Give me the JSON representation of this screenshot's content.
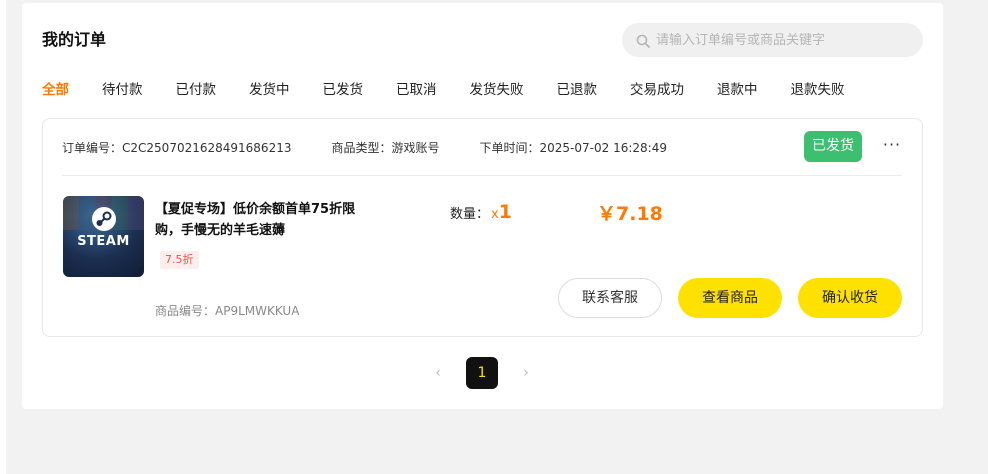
{
  "page": {
    "title": "我的订单"
  },
  "search": {
    "placeholder": "请输入订单编号或商品关键字",
    "icon": "search-icon"
  },
  "tabs": [
    {
      "label": "全部",
      "active": true
    },
    {
      "label": "待付款"
    },
    {
      "label": "已付款"
    },
    {
      "label": "发货中"
    },
    {
      "label": "已发货"
    },
    {
      "label": "已取消"
    },
    {
      "label": "发货失败"
    },
    {
      "label": "已退款"
    },
    {
      "label": "交易成功"
    },
    {
      "label": "退款中"
    },
    {
      "label": "退款失败"
    }
  ],
  "order": {
    "number_label": "订单编号：",
    "number": "C2C2507021628491686213",
    "type_label": "商品类型：",
    "type": "游戏账号",
    "time_label": "下单时间：",
    "time": "2025-07-02 16:28:49",
    "status": "已发货",
    "more": "···",
    "product": {
      "title": "【夏促专场】低价余额首单75折限购，手慢无的羊毛速薅",
      "thumb_text": "STEAM",
      "discount": "7.5折",
      "code_label": "商品编号：",
      "code": "AP9LMWKKUA"
    },
    "quantity_label": "数量：",
    "quantity_x": "x",
    "quantity": "1",
    "price": "￥7.18",
    "buttons": {
      "contact": "联系客服",
      "view": "查看商品",
      "confirm": "确认收货"
    }
  },
  "pagination": {
    "prev": "‹",
    "current": "1",
    "next": "›"
  },
  "colors": {
    "accent": "#ff7a00",
    "status_green": "#3cc06f",
    "yellow": "#ffe100",
    "discount_red": "#e8534a"
  }
}
